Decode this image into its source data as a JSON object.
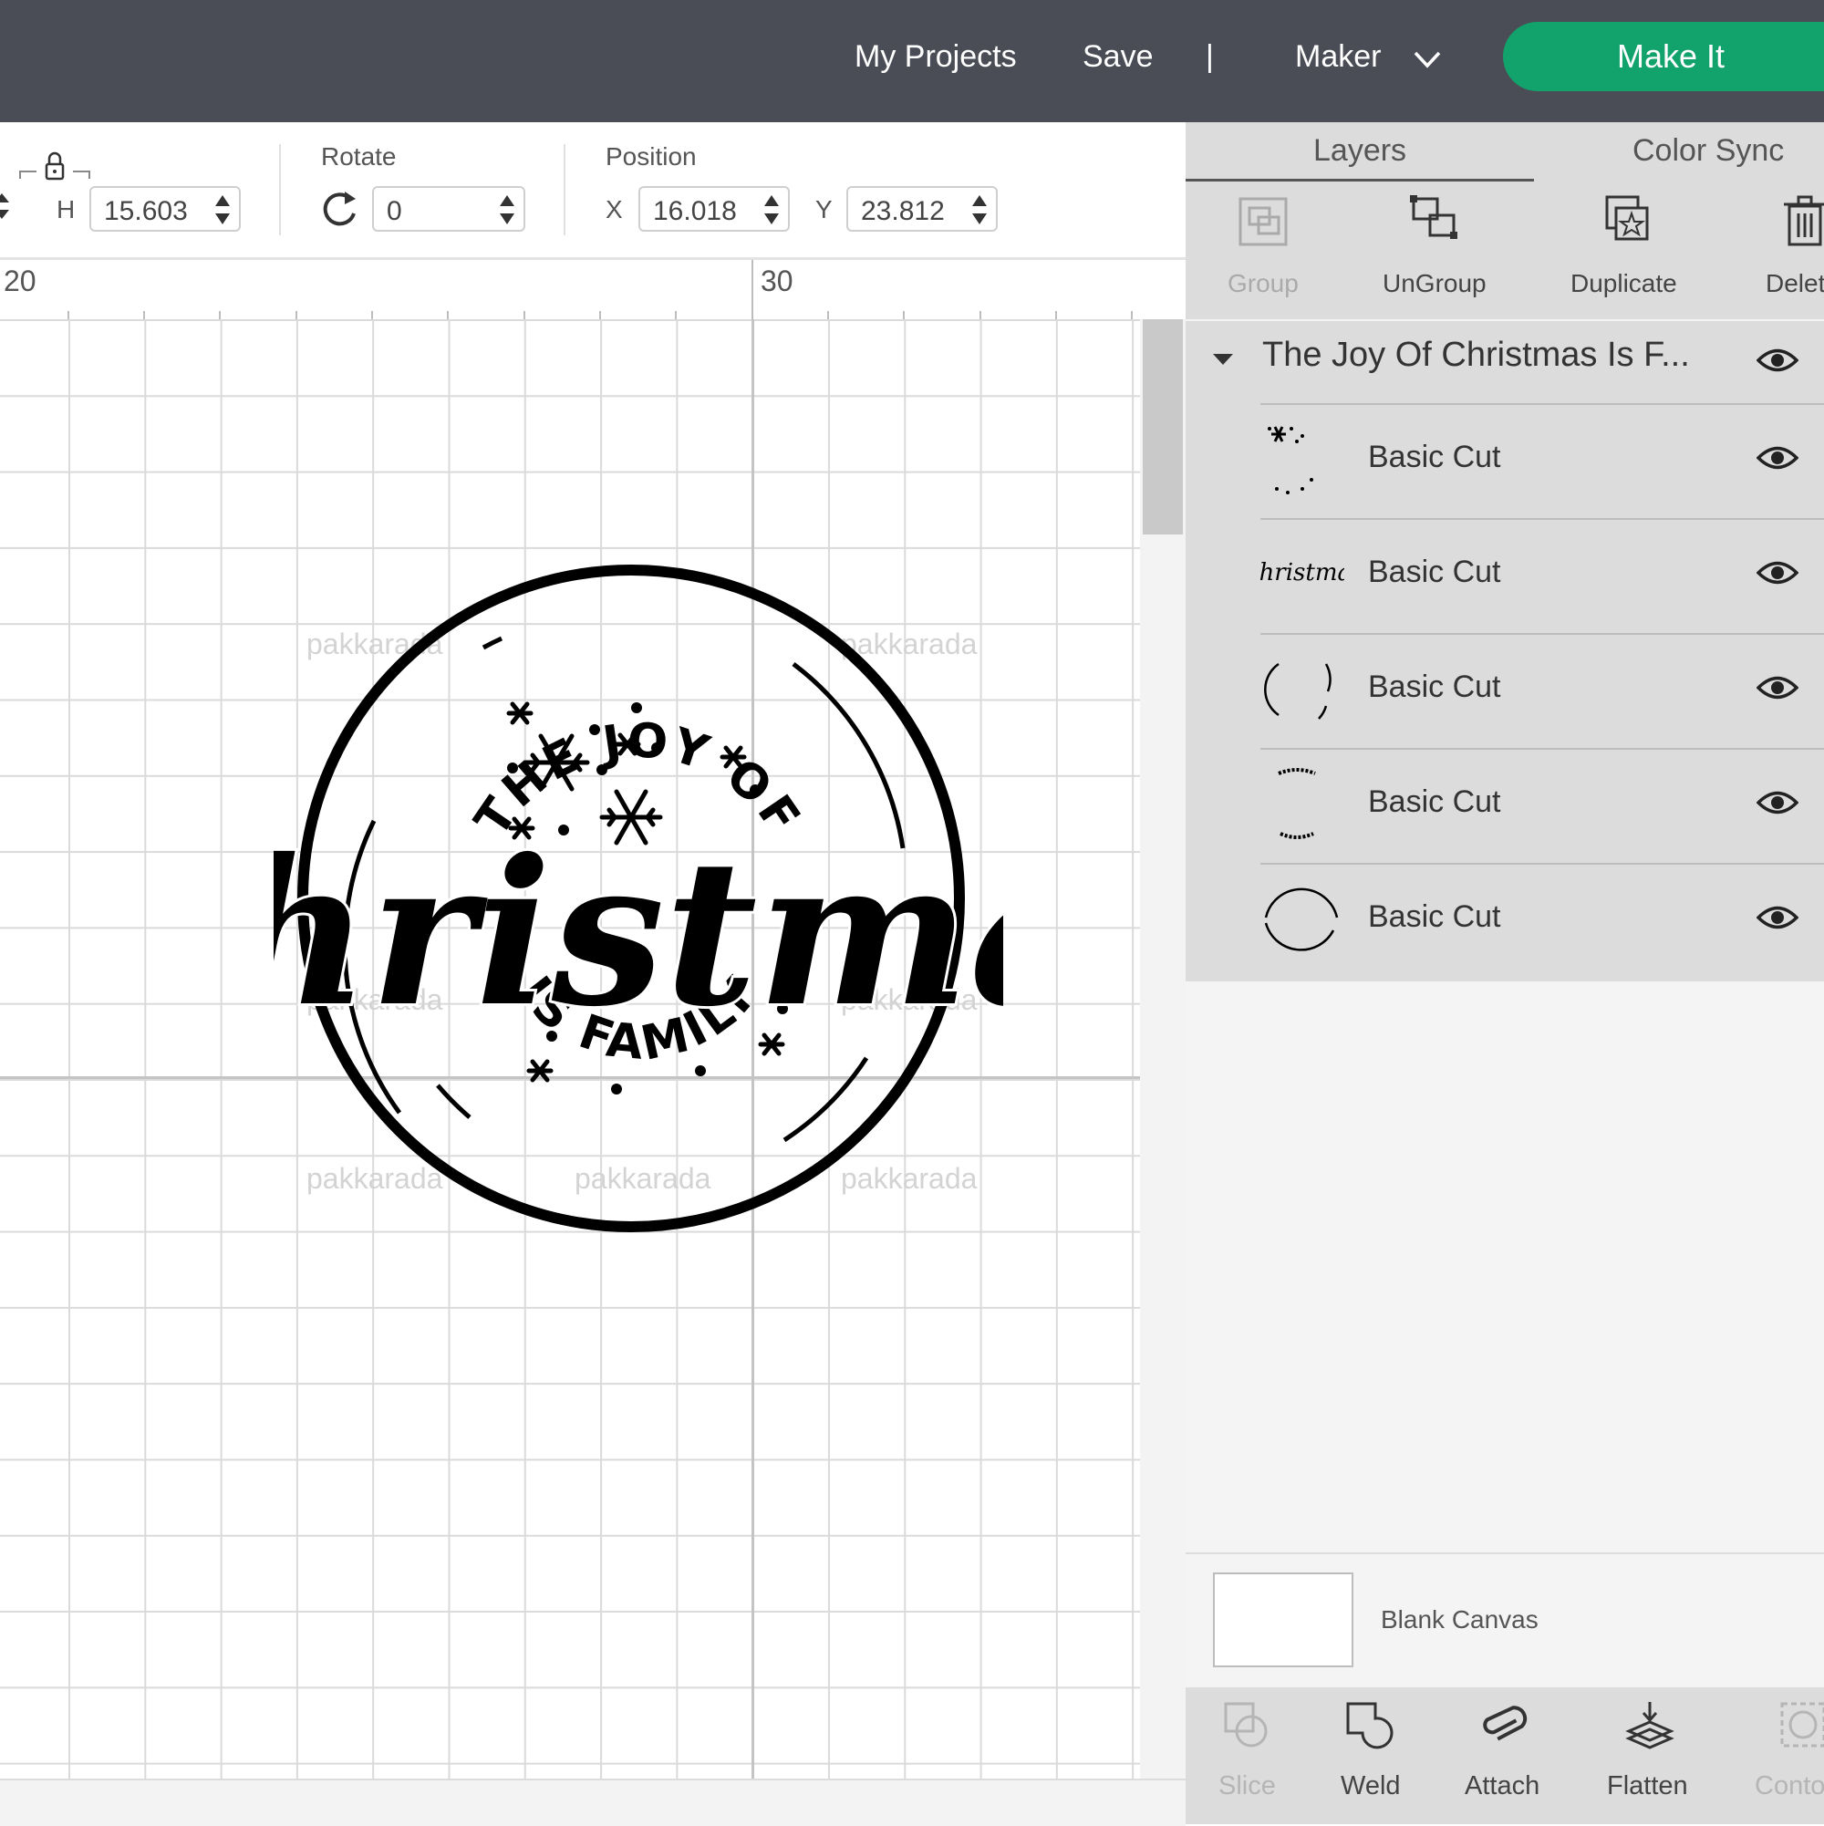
{
  "header": {
    "my_projects": "My Projects",
    "save": "Save",
    "separator": "|",
    "machine": "Maker",
    "make_it": "Make It",
    "bg_color": "#4a4d55",
    "make_it_color": "#12a26b"
  },
  "toolbar": {
    "h_label": "H",
    "h_value": "15.603",
    "rotate_label": "Rotate",
    "rotate_value": "0",
    "position_label": "Position",
    "x_label": "X",
    "x_value": "16.018",
    "y_label": "Y",
    "y_value": "23.812"
  },
  "ruler": {
    "marks": [
      "20",
      "30"
    ]
  },
  "design": {
    "top_text": "THE JOY OF",
    "main_text": "Christmas",
    "bottom_text": "IS FAMILY",
    "watermark": "pakkarada"
  },
  "panel": {
    "tabs": [
      "Layers",
      "Color Sync"
    ],
    "actions": [
      {
        "label": "Group",
        "icon": "group-icon",
        "enabled": false
      },
      {
        "label": "UnGroup",
        "icon": "ungroup-icon",
        "enabled": true
      },
      {
        "label": "Duplicate",
        "icon": "duplicate-icon",
        "enabled": true
      },
      {
        "label": "Delete",
        "icon": "trash-icon",
        "enabled": true
      }
    ],
    "group_title": "The Joy Of Christmas Is F...",
    "layers": [
      {
        "label": "Basic Cut",
        "thumb": "snowflakes"
      },
      {
        "label": "Basic Cut",
        "thumb": "christmas-text"
      },
      {
        "label": "Basic Cut",
        "thumb": "inner-circle"
      },
      {
        "label": "Basic Cut",
        "thumb": "arc-text"
      },
      {
        "label": "Basic Cut",
        "thumb": "outer-circle"
      }
    ],
    "thumb_christmas_text": "Christmas",
    "blank_canvas": "Blank Canvas",
    "bottom_actions": [
      {
        "label": "Slice",
        "icon": "slice-icon",
        "enabled": false
      },
      {
        "label": "Weld",
        "icon": "weld-icon",
        "enabled": true
      },
      {
        "label": "Attach",
        "icon": "paperclip-icon",
        "enabled": true
      },
      {
        "label": "Flatten",
        "icon": "flatten-icon",
        "enabled": true
      },
      {
        "label": "Contour",
        "icon": "contour-icon",
        "enabled": false
      }
    ]
  }
}
